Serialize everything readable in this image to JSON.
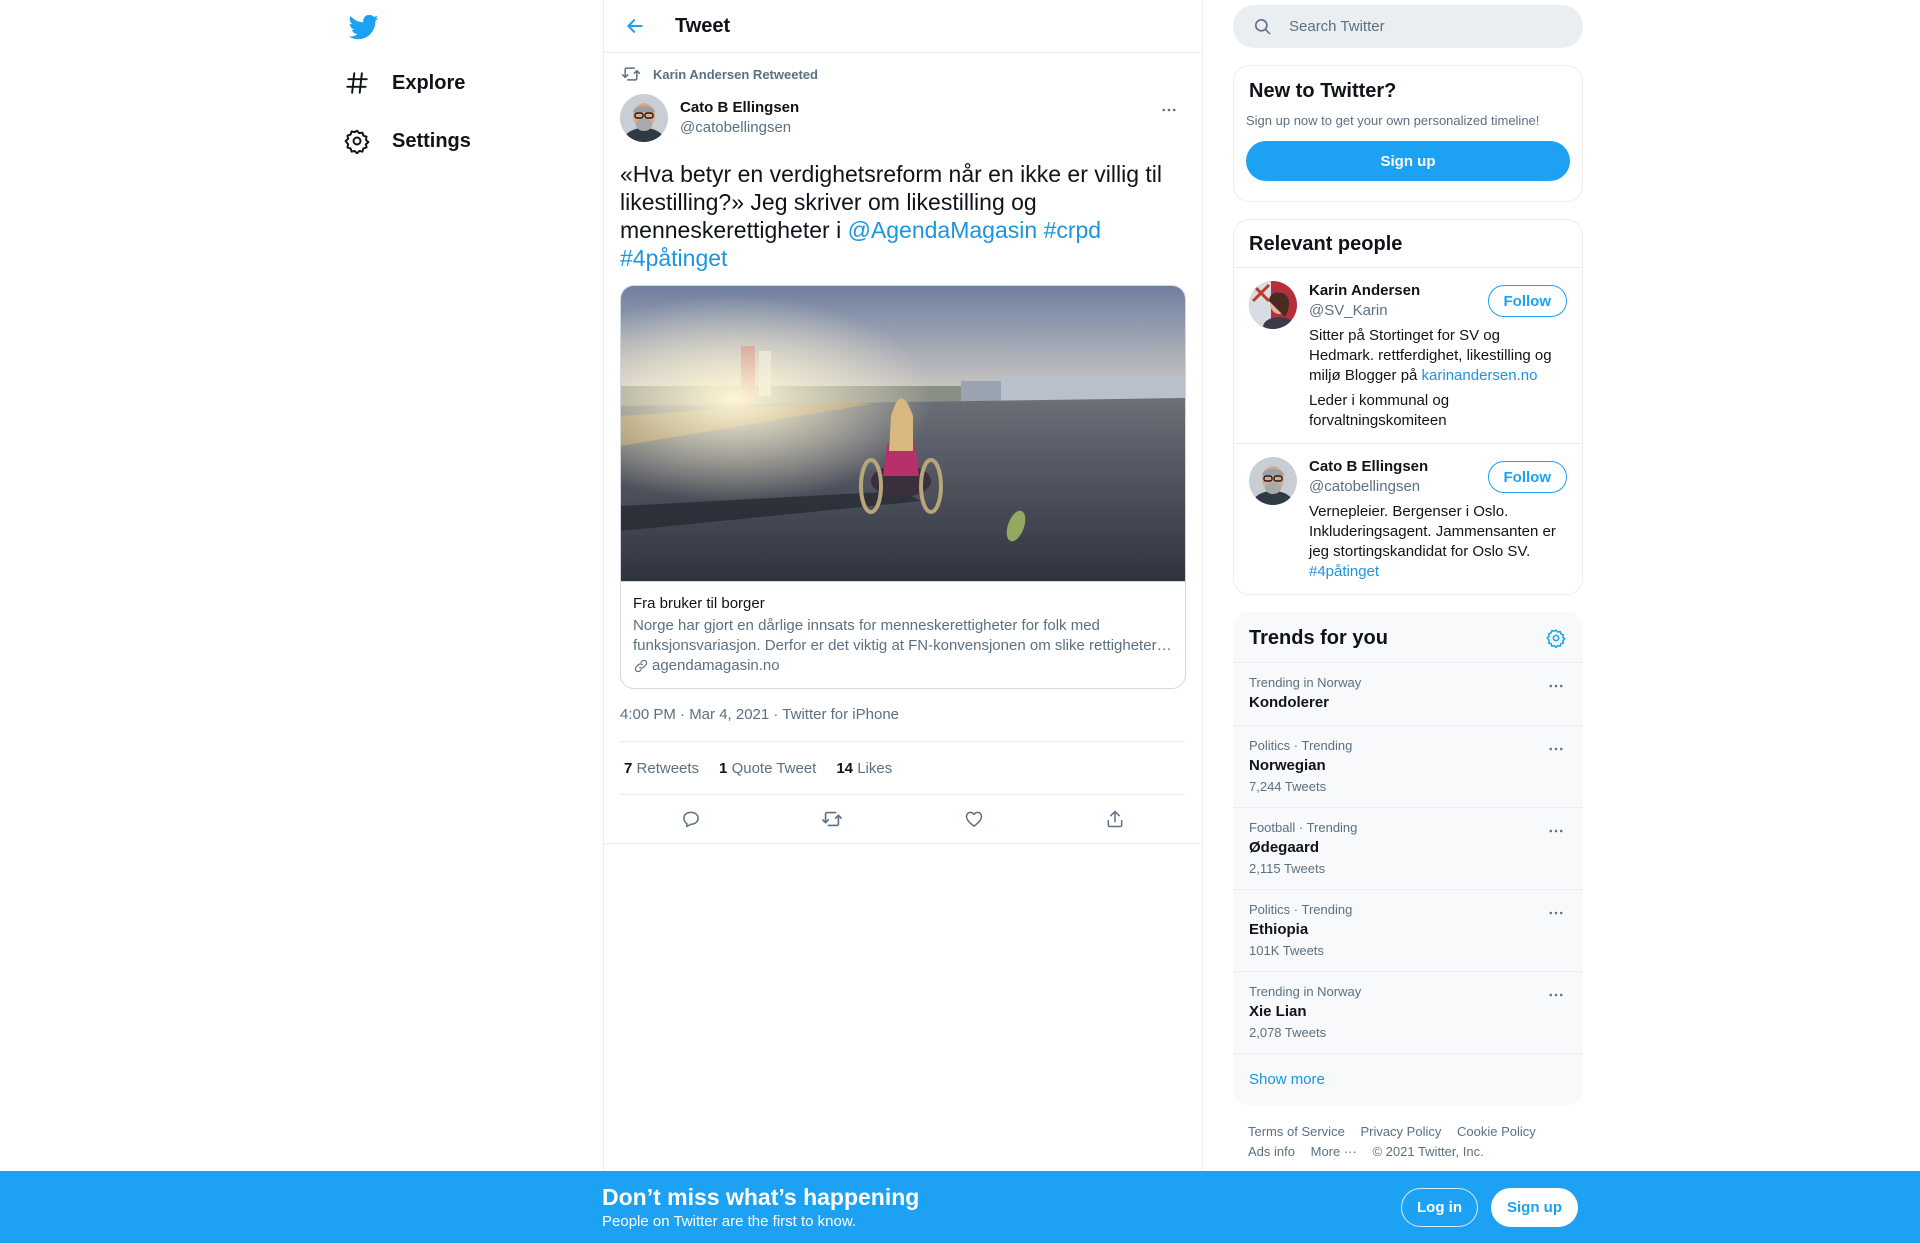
{
  "nav": {
    "logo": "twitter-bird-icon",
    "items": [
      {
        "label": "Explore",
        "icon": "hashtag-icon"
      },
      {
        "label": "Settings",
        "icon": "gear-icon"
      }
    ]
  },
  "header": {
    "title": "Tweet",
    "back_icon": "arrow-left-icon"
  },
  "tweet": {
    "retweeted_by": "Karin Andersen Retweeted",
    "author_name": "Cato B Ellingsen",
    "author_handle": "@catobellingsen",
    "text_parts": {
      "plain": "«Hva betyr en verdighetsreform når en ikke er villig til likestilling?» Jeg skriver om likestilling og menneskerettigheter i ",
      "mention": "@AgendaMagasin",
      "hashtag1": "#crpd",
      "hashtag2": "#4påtinget"
    },
    "card": {
      "title": "Fra bruker til borger",
      "description": "Norge har gjort en dårlige innsats for menneskerettigheter for folk med funksjonsvariasjon. Derfor er det viktig at FN-konvensjonen om slike rettigheter…",
      "domain": "agendamagasin.no"
    },
    "meta": "4:00 PM · Mar 4, 2021 · Twitter for iPhone",
    "stats": {
      "retweets_count": "7",
      "retweets_label": "Retweets",
      "quotes_count": "1",
      "quotes_label": "Quote Tweet",
      "likes_count": "14",
      "likes_label": "Likes"
    }
  },
  "search": {
    "placeholder": "Search Twitter"
  },
  "new_to_twitter": {
    "title": "New to Twitter?",
    "subtitle": "Sign up now to get your own personalized timeline!",
    "button": "Sign up"
  },
  "relevant_people": {
    "title": "Relevant people",
    "people": [
      {
        "name": "Karin Andersen",
        "handle": "@SV_Karin",
        "bio": "Sitter på Stortinget for SV og Hedmark. rettferdighet, likestilling og miljø Blogger på ",
        "bio_link": "karinandersen.no",
        "bio2": "Leder i kommunal og forvaltningskomiteen",
        "follow": "Follow"
      },
      {
        "name": "Cato B Ellingsen",
        "handle": "@catobellingsen",
        "bio": "Vernepleier. Bergenser i Oslo. Inkluderingsagent. Jammensanten er jeg stortingskandidat for Oslo SV. ",
        "bio_link": "#4påtinget",
        "follow": "Follow"
      }
    ]
  },
  "trends": {
    "title": "Trends for you",
    "items": [
      {
        "context": "Trending in Norway",
        "name": "Kondolerer",
        "count": ""
      },
      {
        "context": "Politics · Trending",
        "name": "Norwegian",
        "count": "7,244 Tweets"
      },
      {
        "context": "Football · Trending",
        "name": "Ødegaard",
        "count": "2,115 Tweets"
      },
      {
        "context": "Politics · Trending",
        "name": "Ethiopia",
        "count": "101K Tweets"
      },
      {
        "context": "Trending in Norway",
        "name": "Xie Lian",
        "count": "2,078 Tweets"
      }
    ],
    "show_more": "Show more"
  },
  "footer": {
    "terms": "Terms of Service",
    "privacy": "Privacy Policy",
    "cookie": "Cookie Policy",
    "ads": "Ads info",
    "more": "More ···",
    "copyright": "© 2021 Twitter, Inc."
  },
  "banner": {
    "title": "Don’t miss what’s happening",
    "subtitle": "People on Twitter are the first to know.",
    "login": "Log in",
    "signup": "Sign up"
  },
  "colors": {
    "accent": "#1da1f2",
    "link": "#1b95e0",
    "secondary_text": "#5b7083"
  }
}
